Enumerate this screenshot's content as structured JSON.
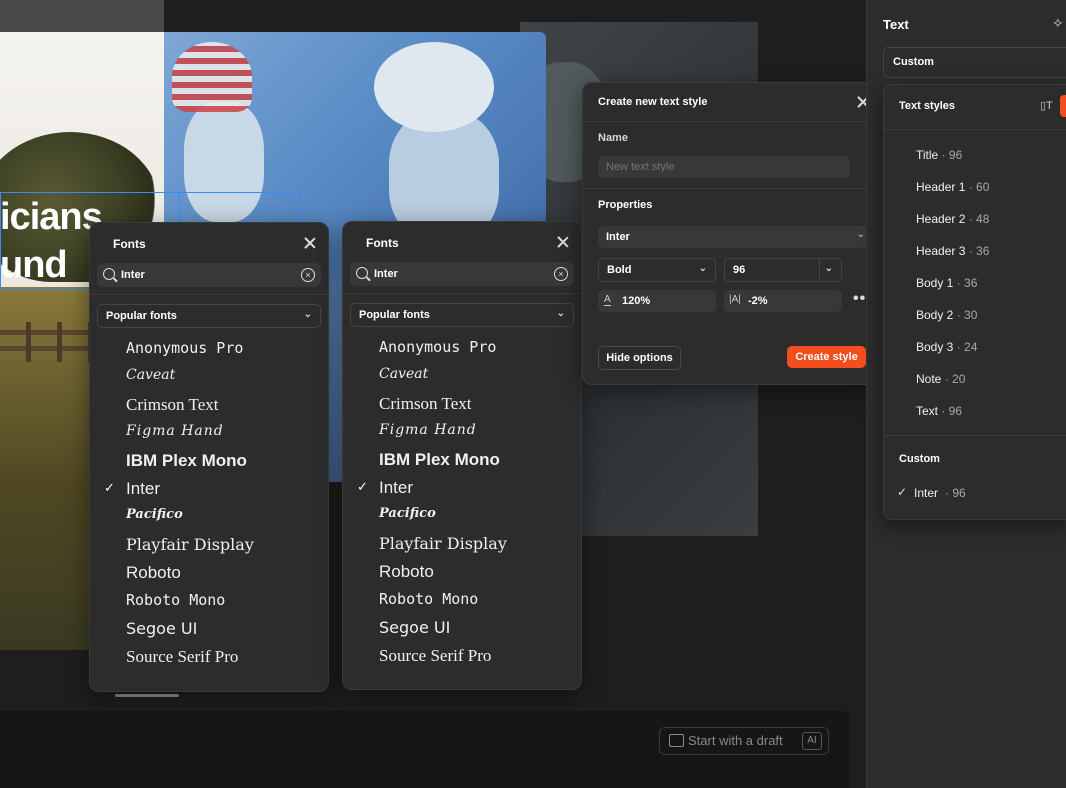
{
  "canvas": {
    "headline_line1": "icians",
    "headline_line2": "und",
    "draft_button": "Start with a draft",
    "ai_badge": "AI"
  },
  "fonts_panel_1": {
    "title": "Fonts",
    "search_value": "Inter",
    "category": "Popular fonts",
    "selected": "Inter",
    "fonts": [
      "Anonymous Pro",
      "Caveat",
      "Crimson Text",
      "Figma Hand",
      "IBM Plex Mono",
      "Inter",
      "Pacifico",
      "Playfair Display",
      "Roboto",
      "Roboto Mono",
      "Segoe UI",
      "Source Serif Pro"
    ]
  },
  "fonts_panel_2": {
    "title": "Fonts",
    "search_value": "Inter",
    "category": "Popular fonts",
    "selected": "Inter",
    "fonts": [
      "Anonymous Pro",
      "Caveat",
      "Crimson Text",
      "Figma Hand",
      "IBM Plex Mono",
      "Inter",
      "Pacifico",
      "Playfair Display",
      "Roboto",
      "Roboto Mono",
      "Segoe UI",
      "Source Serif Pro"
    ]
  },
  "create_style": {
    "title": "Create new text style",
    "name_label": "Name",
    "name_placeholder": "New text style",
    "properties_label": "Properties",
    "font_family": "Inter",
    "font_weight": "Bold",
    "font_size": "96",
    "line_height": "120%",
    "letter_spacing": "-2%",
    "hide_options": "Hide options",
    "create_button": "Create style"
  },
  "sidebar": {
    "title": "Text",
    "style_select": "Custom",
    "text_styles_title": "Text styles",
    "styles": [
      {
        "name": "Title",
        "size": "96"
      },
      {
        "name": "Header 1",
        "size": "60"
      },
      {
        "name": "Header 2",
        "size": "48"
      },
      {
        "name": "Header 3",
        "size": "36"
      },
      {
        "name": "Body 1",
        "size": "36"
      },
      {
        "name": "Body 2",
        "size": "30"
      },
      {
        "name": "Body 3",
        "size": "24"
      },
      {
        "name": "Note",
        "size": "20"
      },
      {
        "name": "Text",
        "size": "96"
      }
    ],
    "custom_title": "Custom",
    "custom_style": {
      "name": "Inter",
      "size": "96"
    }
  },
  "colors": {
    "accent_orange": "#f24e1e",
    "selection_blue": "#3d8bf2",
    "panel_bg": "#2c2c2c"
  }
}
